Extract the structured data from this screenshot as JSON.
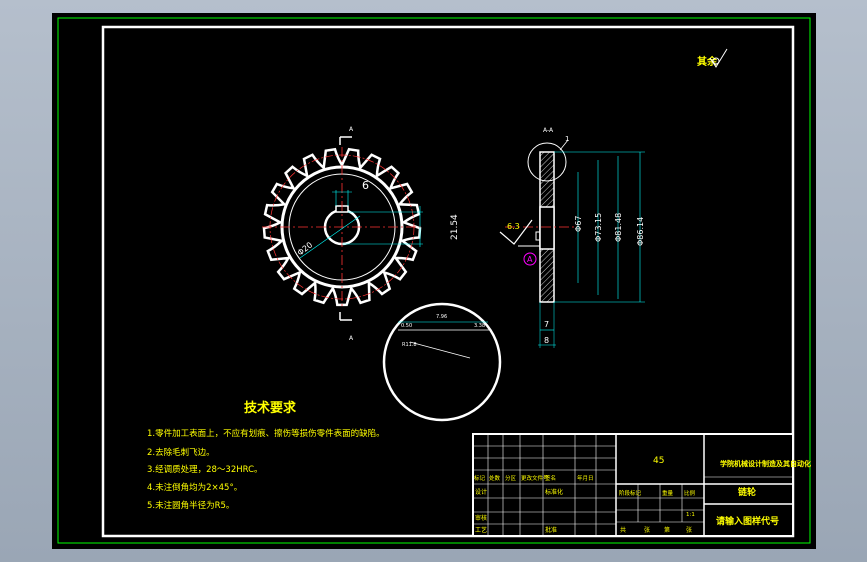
{
  "colors": {
    "viewport_bg": "#a9b4c2",
    "canvas_bg": "#000000",
    "border": "#ffffff",
    "outline": "#00ff00",
    "dimension": "#00ffff",
    "centerline": "#ff3333",
    "text": "#ffff00",
    "accent": "#ff00ff"
  },
  "roughness_note": "其余",
  "front_view": {
    "section_mark_top": "A",
    "section_mark_bottom": "A",
    "dim_keyway_width": "6",
    "dim_bore_diameter": "Φ20",
    "dim_keyway_depth": "21.54"
  },
  "side_view": {
    "detail_label": "1",
    "surface_note": "6.3",
    "datum_label": "A",
    "dim_root": "Φ67",
    "dim_pitch": "Φ73.15",
    "dim_outer_a": "Φ81.48",
    "dim_outer_b": "Φ86.14",
    "dim_width_1": "7",
    "dim_width_2": "8"
  },
  "detail_view": {
    "dim_a": "7.96",
    "dim_b": "0.50",
    "dim_c": "3.38",
    "dim_r": "R11.8"
  },
  "tech_requirements": {
    "title": "技术要求",
    "items": [
      "1.零件加工表面上，不应有划痕、擦伤等损伤零件表面的缺陷。",
      "2.去除毛刺飞边。",
      "3.经调质处理，28～32HRC。",
      "4.未注倒角均为2×45°。",
      "5.未注圆角半径为R5。"
    ]
  },
  "title_block": {
    "material": "45",
    "company": "学院机械设计制造及其自动化",
    "part_name": "链轮",
    "drawing_code": "请输入图样代号",
    "scale": "1:1",
    "change_row": [
      "标记",
      "处数",
      "分区",
      "更改文件号",
      "签名",
      "年月日"
    ],
    "design_label": "设计",
    "standardize_label": "标准化",
    "review_label": "审核",
    "process_label": "工艺",
    "approve_label": "批准",
    "stage_row": [
      "阶段标记",
      "重量",
      "比例"
    ],
    "sheet_row": [
      "共",
      "张",
      "第",
      "张"
    ]
  }
}
